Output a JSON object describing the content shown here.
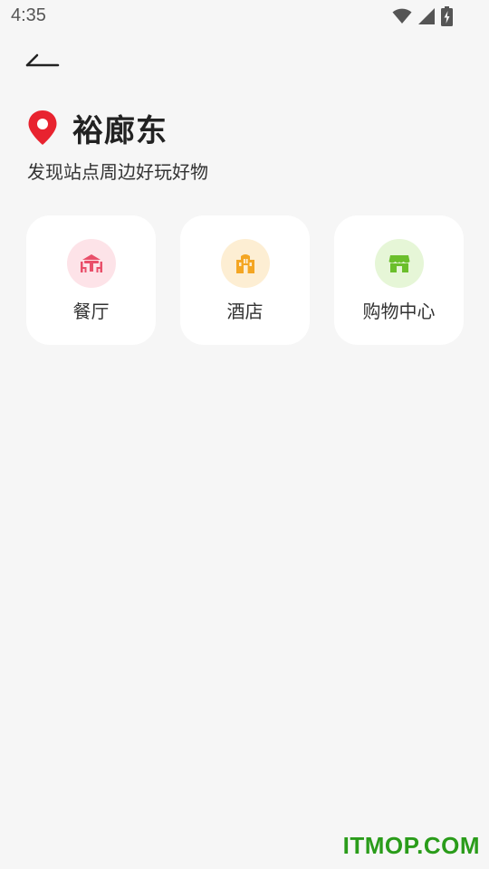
{
  "status_bar": {
    "time": "4:35",
    "icons": [
      "wifi-icon",
      "cellular-signal-icon",
      "battery-charging-icon"
    ]
  },
  "header": {
    "back_icon": "arrow-left-icon"
  },
  "station": {
    "pin_icon": "location-pin-icon",
    "pin_color": "#e8232f",
    "name": "裕廊东",
    "subtitle": "发现站点周边好玩好物"
  },
  "categories": [
    {
      "label": "餐厅",
      "icon": "restaurant-icon",
      "icon_color": "#e94f6a",
      "bg_color": "#fde3e8"
    },
    {
      "label": "酒店",
      "icon": "hotel-icon",
      "icon_color": "#f4a623",
      "bg_color": "#fdeed3"
    },
    {
      "label": "购物中心",
      "icon": "shop-icon",
      "icon_color": "#6bbf2b",
      "bg_color": "#e6f6d7"
    }
  ],
  "watermark": {
    "text": "ITMOP.COM",
    "color": "#2a9c1a"
  }
}
